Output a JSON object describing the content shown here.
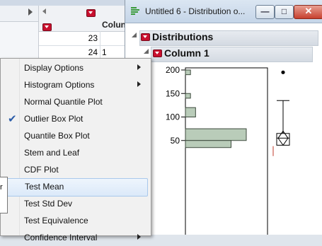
{
  "table": {
    "column_name": "Colun",
    "rows": [
      {
        "number": "23",
        "value": ""
      },
      {
        "number": "24",
        "value": "1"
      }
    ]
  },
  "window": {
    "title": "Untitled 6 - Distribution o...",
    "minimize_symbol": "—",
    "restore_symbol": "□",
    "close_symbol": "✕"
  },
  "report": {
    "section_title": "Distributions",
    "column_title": "Column 1"
  },
  "chart_data": {
    "type": "bar",
    "orientation": "horizontal",
    "y_ticks": [
      200,
      150,
      100,
      50
    ],
    "ylim": [
      35,
      200
    ],
    "bins": [
      {
        "from": 190,
        "to": 200,
        "count": 1
      },
      {
        "from": 140,
        "to": 150,
        "count": 1
      },
      {
        "from": 100,
        "to": 120,
        "count": 2
      },
      {
        "from": 50,
        "to": 75,
        "count": 12
      },
      {
        "from": 35,
        "to": 50,
        "count": 9
      }
    ],
    "max_count": 12,
    "box_plot": {
      "outlier": 195,
      "upper_whisker": 135,
      "q3": 65,
      "median": 55,
      "q1": 40,
      "mean": 55
    },
    "bar_color": "#b9ccb9"
  },
  "menu": {
    "items": [
      {
        "label": "Display Options",
        "submenu": true,
        "checked": false,
        "highlighted": false
      },
      {
        "label": "Histogram Options",
        "submenu": true,
        "checked": false,
        "highlighted": false
      },
      {
        "label": "Normal Quantile Plot",
        "submenu": false,
        "checked": false,
        "highlighted": false
      },
      {
        "label": "Outlier Box Plot",
        "submenu": false,
        "checked": true,
        "highlighted": false
      },
      {
        "label": "Quantile Box Plot",
        "submenu": false,
        "checked": false,
        "highlighted": false
      },
      {
        "label": "Stem and Leaf",
        "submenu": false,
        "checked": false,
        "highlighted": false
      },
      {
        "label": "CDF Plot",
        "submenu": false,
        "checked": false,
        "highlighted": false
      },
      {
        "label": "Test Mean",
        "submenu": false,
        "checked": false,
        "highlighted": true
      },
      {
        "label": "Test Std Dev",
        "submenu": false,
        "checked": false,
        "highlighted": false
      },
      {
        "label": "Test Equivalence",
        "submenu": false,
        "checked": false,
        "highlighted": false
      },
      {
        "label": "Confidence Interval",
        "submenu": true,
        "checked": false,
        "highlighted": false
      }
    ],
    "check_glyph": "✔"
  },
  "tooltip_fragment": "r"
}
